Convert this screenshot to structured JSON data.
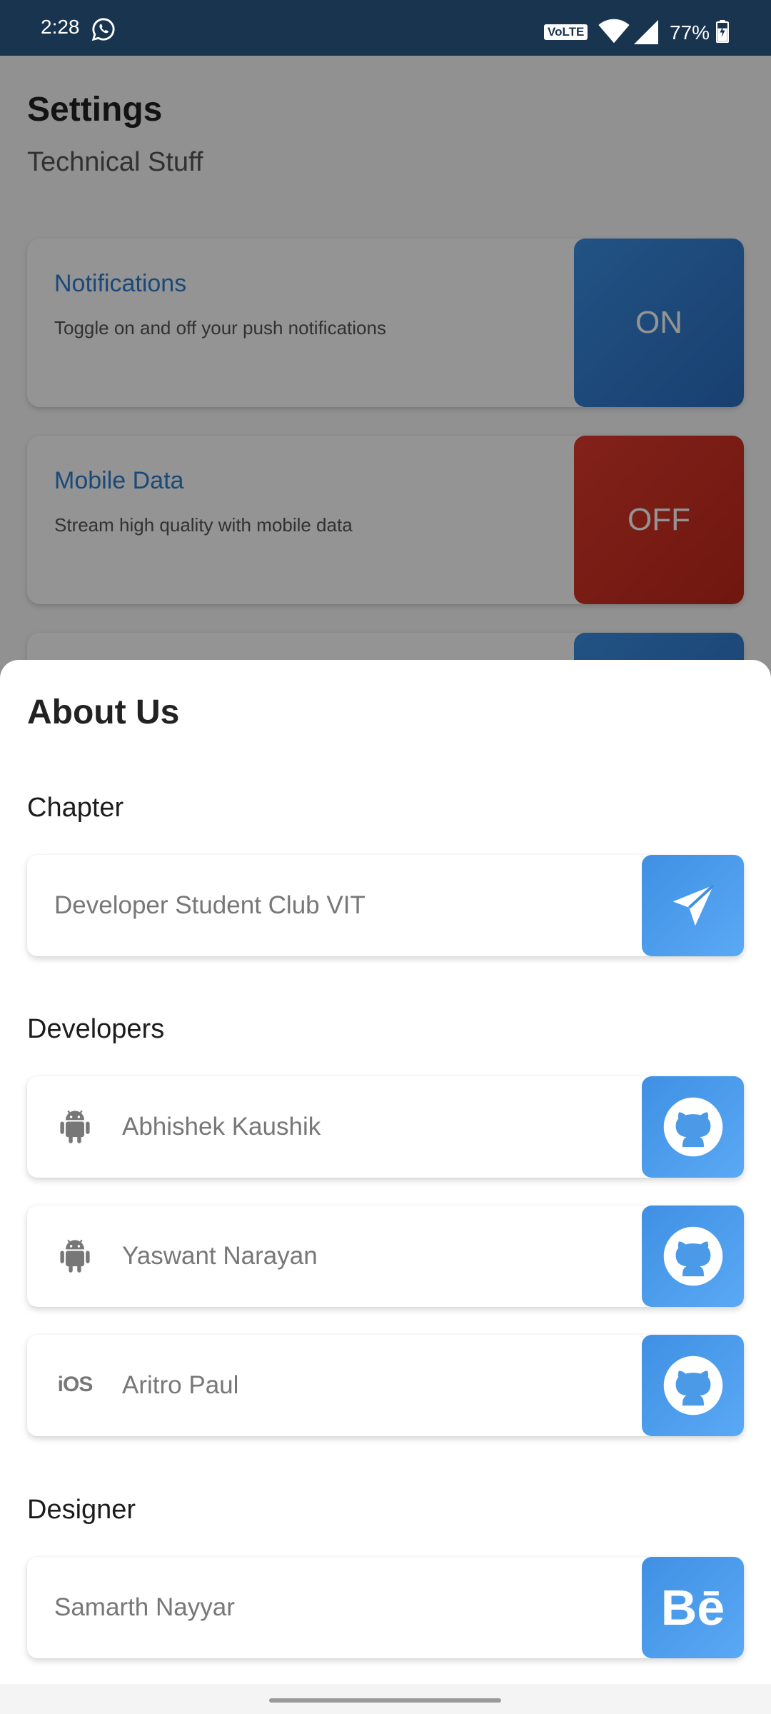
{
  "status_bar": {
    "time": "2:28",
    "volte": "VoLTE",
    "battery": "77%"
  },
  "settings_page": {
    "title": "Settings",
    "subtitle": "Technical Stuff",
    "items": [
      {
        "name": "Notifications",
        "description": "Toggle on and off your push notifications",
        "state": "ON"
      },
      {
        "name": "Mobile Data",
        "description": "Stream high quality with mobile data",
        "state": "OFF"
      }
    ]
  },
  "about_sheet": {
    "heading": "About Us",
    "chapter": {
      "label": "Chapter",
      "name": "Developer Student Club VIT",
      "action_icon": "send-icon"
    },
    "developers": {
      "label": "Developers",
      "items": [
        {
          "name": "Abhishek Kaushik",
          "platform_icon": "android-icon",
          "action_icon": "github-icon"
        },
        {
          "name": "Yaswant Narayan",
          "platform_icon": "android-icon",
          "action_icon": "github-icon"
        },
        {
          "name": "Aritro Paul",
          "platform_icon": "ios-icon",
          "platform_text": "iOS",
          "action_icon": "github-icon"
        }
      ]
    },
    "designer": {
      "label": "Designer",
      "name": "Samarth Nayyar",
      "action_icon": "behance-icon",
      "action_text": "Bē"
    }
  },
  "colors": {
    "status_bar": "#19344f",
    "accent_blue": "#3f90e4",
    "on_toggle": "#2a6fc0",
    "off_toggle": "#d03224"
  }
}
